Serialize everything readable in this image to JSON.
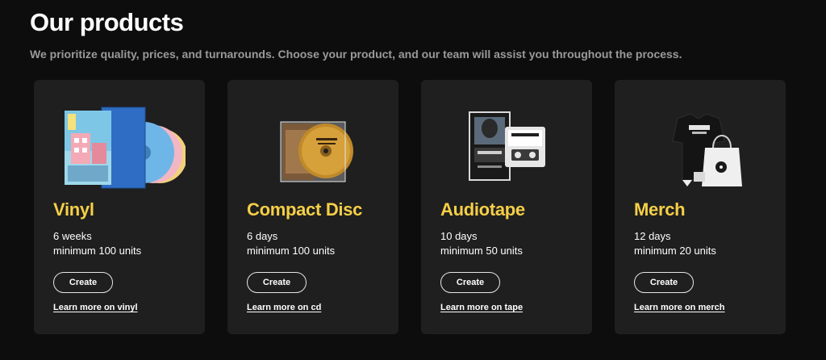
{
  "header": {
    "title": "Our products",
    "subtitle": "We prioritize quality, prices, and turnarounds. Choose your product, and our team will assist you throughout the process."
  },
  "accent_color": "#f5cf47",
  "products": [
    {
      "name": "Vinyl",
      "lead_time": "6 weeks",
      "minimum": "minimum 100 units",
      "create_label": "Create",
      "learn_label": "Learn more on vinyl",
      "image_icon": "vinyl-records-icon"
    },
    {
      "name": "Compact Disc",
      "lead_time": "6 days",
      "minimum": "minimum 100 units",
      "create_label": "Create",
      "learn_label": "Learn more on cd",
      "image_icon": "compact-disc-icon"
    },
    {
      "name": "Audiotape",
      "lead_time": "10 days",
      "minimum": "minimum 50 units",
      "create_label": "Create",
      "learn_label": "Learn more on tape",
      "image_icon": "cassette-tape-icon"
    },
    {
      "name": "Merch",
      "lead_time": "12 days",
      "minimum": "minimum 20 units",
      "create_label": "Create",
      "learn_label": "Learn more on merch",
      "image_icon": "merch-icon"
    }
  ]
}
